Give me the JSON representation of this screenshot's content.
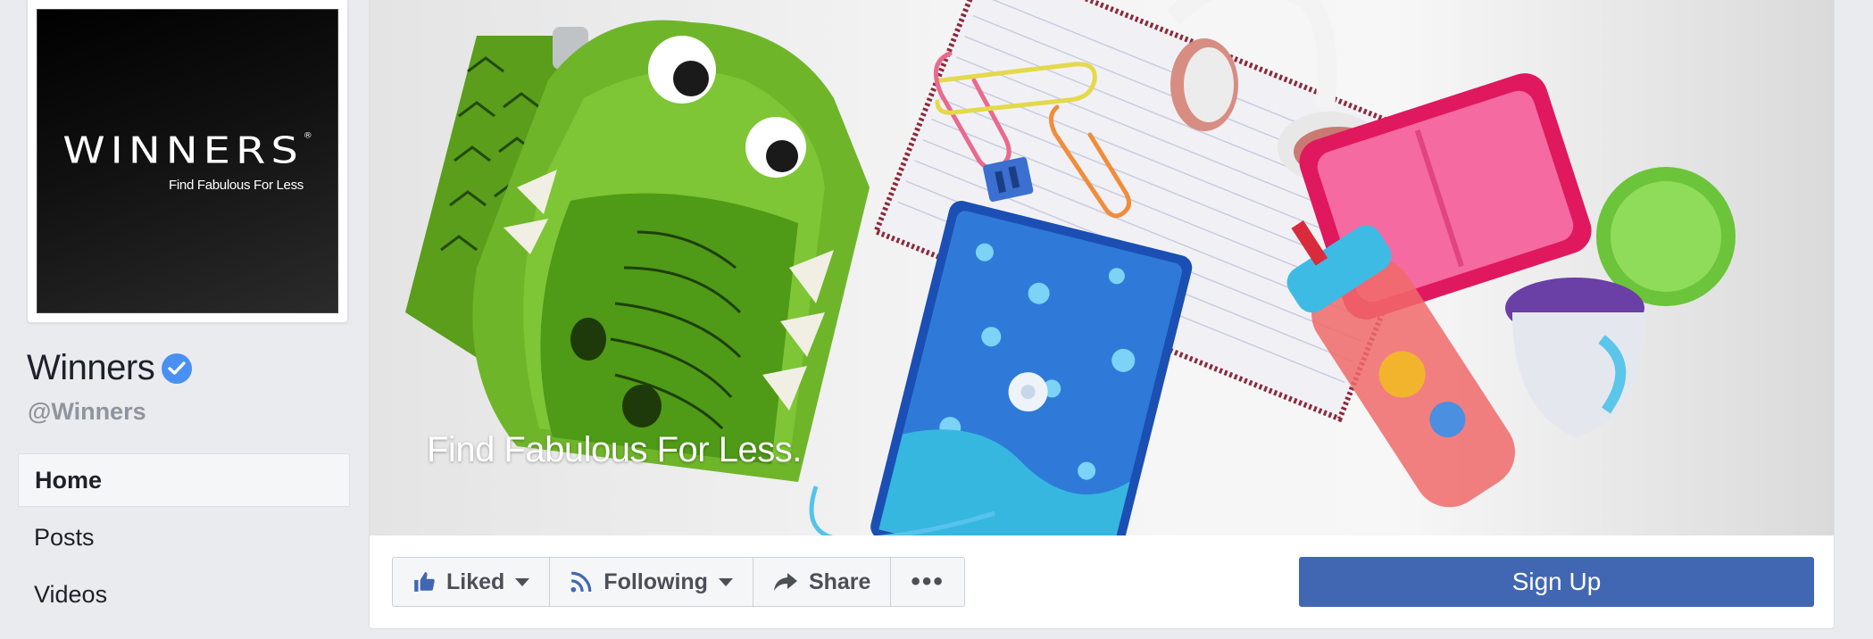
{
  "profile": {
    "logo_word": "WINNERS",
    "logo_tagline": "Find Fabulous For Less",
    "name": "Winners",
    "handle": "@Winners"
  },
  "nav": {
    "items": [
      {
        "label": "Home",
        "active": true
      },
      {
        "label": "Posts",
        "active": false
      },
      {
        "label": "Videos",
        "active": false
      }
    ]
  },
  "cover": {
    "caption": "Find Fabulous For Less."
  },
  "actions": {
    "liked_label": "Liked",
    "following_label": "Following",
    "share_label": "Share",
    "more_label": "•••",
    "signup_label": "Sign Up"
  },
  "colors": {
    "brand_blue": "#4267b2",
    "verified_blue": "#4a90f2",
    "page_bg": "#e9ebee"
  }
}
